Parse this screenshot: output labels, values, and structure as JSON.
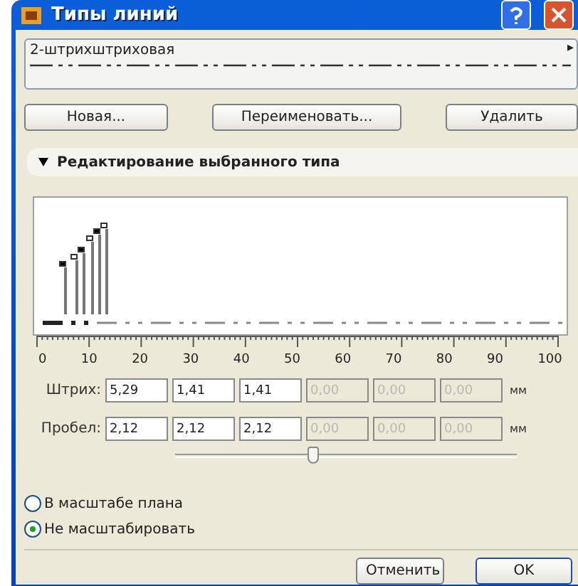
{
  "window": {
    "title": "Типы линий"
  },
  "line_type": {
    "name": "2-штрихштриховая",
    "arrow": "▸"
  },
  "buttons": [
    "Новая...",
    "Переименовать...",
    "Удалить"
  ],
  "section": {
    "title": "Редактирование выбранного типа",
    "expanded": true
  },
  "ruler": [
    "0",
    "10",
    "20",
    "30",
    "40",
    "50",
    "60",
    "70",
    "80",
    "90",
    "100"
  ],
  "rows": [
    {
      "label": "Штрих:",
      "unit": "мм",
      "fields": [
        {
          "value": "5,29",
          "disabled": false
        },
        {
          "value": "1,41",
          "disabled": false
        },
        {
          "value": "1,41",
          "disabled": false
        },
        {
          "value": "0,00",
          "disabled": true
        },
        {
          "value": "0,00",
          "disabled": true
        },
        {
          "value": "0,00",
          "disabled": true
        }
      ]
    },
    {
      "label": "Пробел:",
      "unit": "мм",
      "fields": [
        {
          "value": "2,12",
          "disabled": false
        },
        {
          "value": "2,12",
          "disabled": false
        },
        {
          "value": "2,12",
          "disabled": false
        },
        {
          "value": "0,00",
          "disabled": true
        },
        {
          "value": "0,00",
          "disabled": true
        },
        {
          "value": "0,00",
          "disabled": true
        }
      ]
    }
  ],
  "zoom_slider": {
    "level": 0.4
  },
  "scale_options": [
    {
      "label": "В масштабе плана",
      "selected": false
    },
    {
      "label": "Не масштабировать",
      "selected": true
    }
  ],
  "footer_buttons": [
    {
      "label": "Отменить",
      "default": false
    },
    {
      "label": "OK",
      "default": true
    }
  ]
}
